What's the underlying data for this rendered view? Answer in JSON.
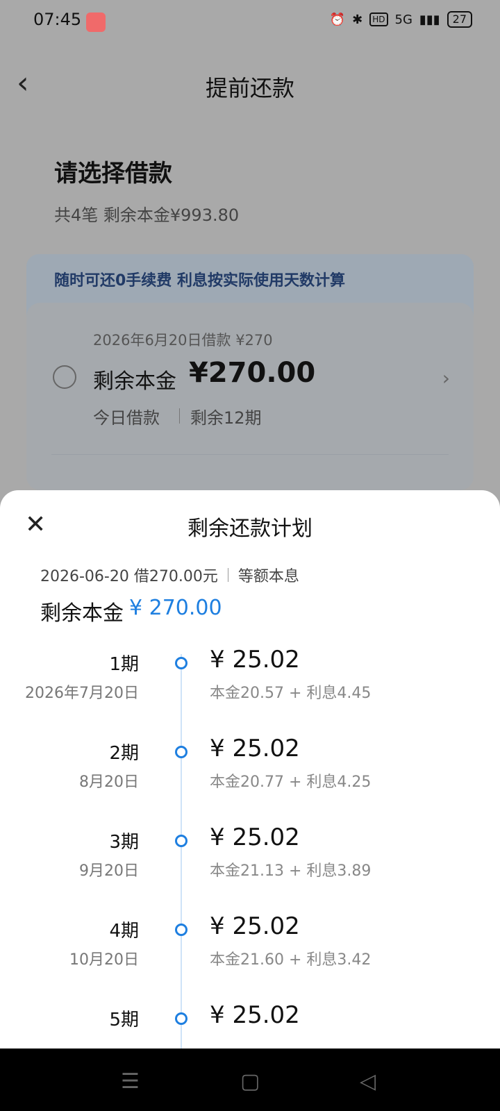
{
  "status": {
    "time": "07:45",
    "battery": "27",
    "network": "5G",
    "hd": "HD"
  },
  "header": {
    "title": "提前还款"
  },
  "section": {
    "title": "请选择借款",
    "subtitle": "共4笔 剩余本金¥993.80"
  },
  "banner": {
    "text": "随时可还0手续费 利息按实际使用天数计算"
  },
  "loan": {
    "date": "2026年6月20日借款 ¥270",
    "principal_label": "剩余本金",
    "principal_amount": "¥270.00",
    "today": "今日借款",
    "periods": "剩余12期"
  },
  "sheet": {
    "title": "剩余还款计划",
    "meta_left": "2026-06-20 借270.00元",
    "meta_right": "等额本息",
    "remain_label": "剩余本金",
    "remain_amount": "¥ 270.00",
    "installments": [
      {
        "period": "1期",
        "date": "2026年7月20日",
        "amount": "¥ 25.02",
        "detail": "本金20.57 + 利息4.45"
      },
      {
        "period": "2期",
        "date": "8月20日",
        "amount": "¥ 25.02",
        "detail": "本金20.77 + 利息4.25"
      },
      {
        "period": "3期",
        "date": "9月20日",
        "amount": "¥ 25.02",
        "detail": "本金21.13 + 利息3.89"
      },
      {
        "period": "4期",
        "date": "10月20日",
        "amount": "¥ 25.02",
        "detail": "本金21.60 + 利息3.42"
      },
      {
        "period": "5期",
        "date": "",
        "amount": "¥ 25.02",
        "detail": ""
      }
    ]
  },
  "icons": {
    "back": "back-chevron-icon",
    "close": "close-icon",
    "arrow": "chevron-right-icon"
  }
}
